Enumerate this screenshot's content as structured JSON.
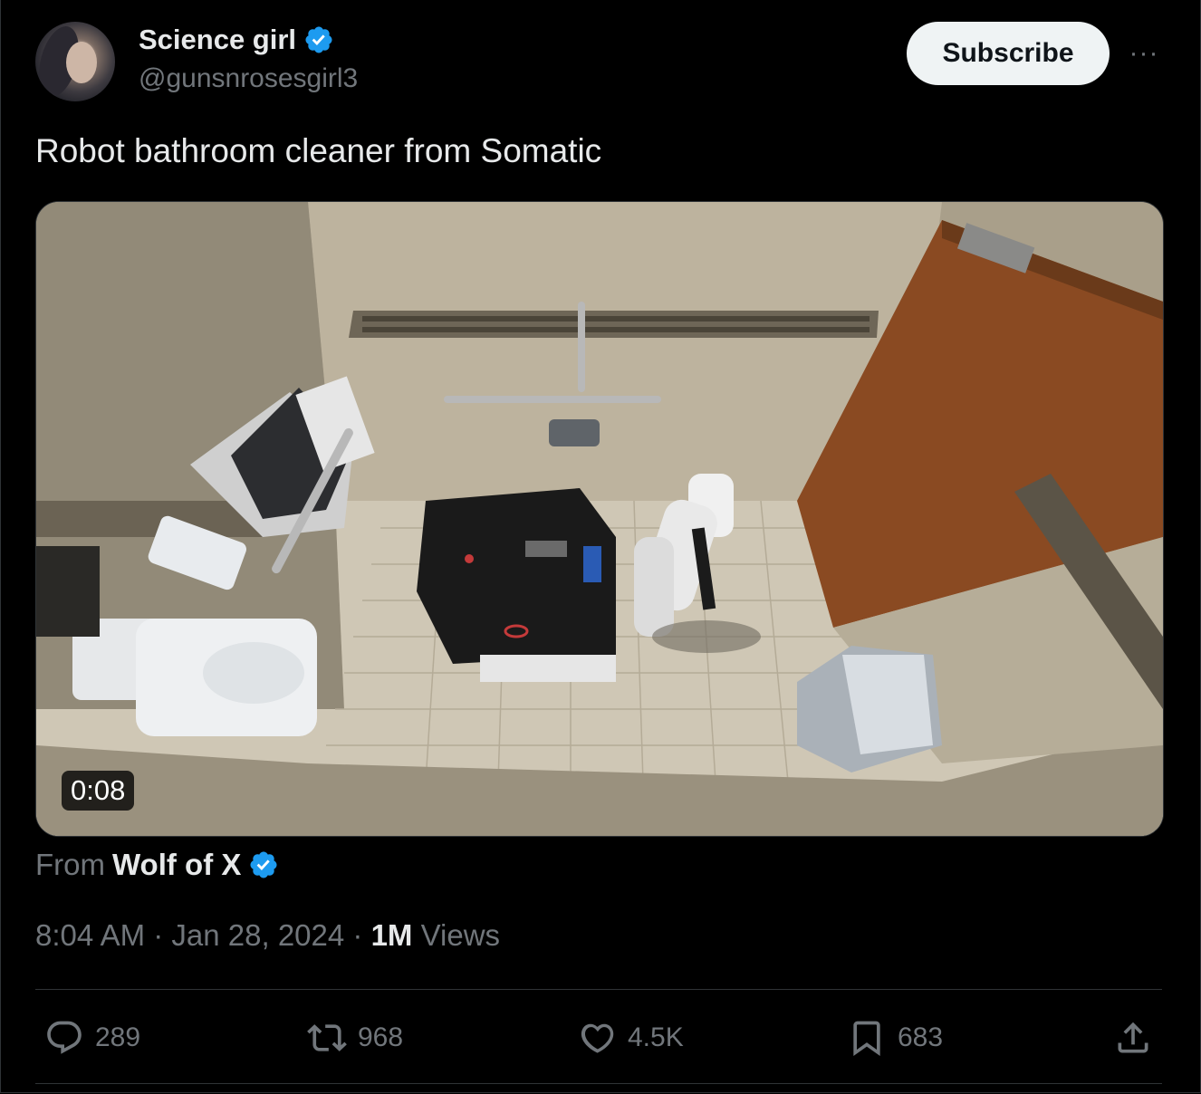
{
  "author": {
    "name": "Science girl",
    "handle": "@gunsnrosesgirl3",
    "verified": true
  },
  "subscribe_label": "Subscribe",
  "more_icon": "more-horizontal-icon",
  "tweet_text": "Robot bathroom cleaner from Somatic",
  "media": {
    "type": "video",
    "duration": "0:08"
  },
  "source": {
    "prefix": "From",
    "name": "Wolf of X",
    "verified": true
  },
  "meta": {
    "time": "8:04 AM",
    "sep1": " · ",
    "date": "Jan 28, 2024",
    "sep2": " · ",
    "views_count": "1M",
    "views_label": " Views"
  },
  "actions": {
    "replies": "289",
    "reposts": "968",
    "likes": "4.5K",
    "bookmarks": "683"
  },
  "colors": {
    "background": "#000000",
    "verified_blue": "#1d9bf0",
    "muted_text": "#71767b",
    "primary_text": "#e7e9ea"
  }
}
